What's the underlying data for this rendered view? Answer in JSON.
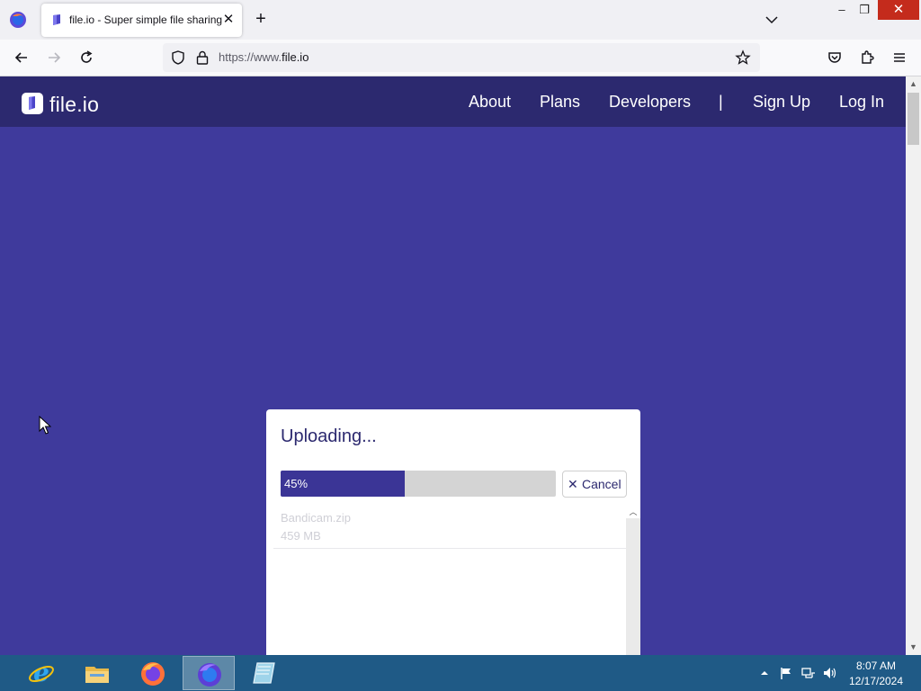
{
  "browser": {
    "tab_title": "file.io - Super simple file sharing",
    "tab_close": "✕",
    "new_tab": "+",
    "url_prefix": "https://www.",
    "url_domain": "file.io",
    "window_controls": {
      "minimize": "–",
      "maximize": "❐",
      "close": "✕"
    }
  },
  "site": {
    "brand": "file.io",
    "nav": [
      "About",
      "Plans",
      "Developers",
      "|",
      "Sign Up",
      "Log In"
    ]
  },
  "upload": {
    "title": "Uploading...",
    "progress_percent": 45,
    "progress_label": "45%",
    "cancel_label": "Cancel",
    "cancel_icon": "✕",
    "file": {
      "name": "Bandicam.zip",
      "size": "459 MB"
    }
  },
  "taskbar": {
    "apps": [
      "internet-explorer",
      "file-explorer",
      "firefox",
      "firefox-developer",
      "notepad"
    ],
    "active_app": "firefox-developer",
    "time": "8:07 AM",
    "date": "12/17/2024"
  },
  "colors": {
    "page_background": "#3f3a9c",
    "header_background": "#2c296f",
    "progress_fill": "#3b3596",
    "taskbar": "#1f5a86"
  }
}
